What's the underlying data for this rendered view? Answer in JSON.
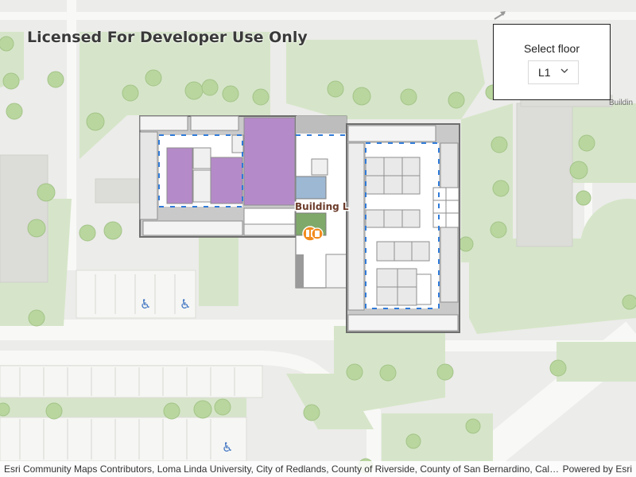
{
  "map": {
    "watermark": "Licensed For Developer Use Only",
    "building_label": "Building L",
    "edge_label": "Buildin"
  },
  "floor_picker": {
    "title": "Select floor",
    "selected": "L1"
  },
  "attribution": {
    "text": "Esri Community Maps Contributors, Loma Linda University, City of Redlands, County of Riverside, County of San Bernardino, California State Parks, © OpenStreetMap, Microsoft, Esri, TomTom, Garmin, SafeGraph, GeoTechnologies, Inc, METI/NASA, USGS, Bureau of Land Management, EPA, NPS, US Census Bureau, USDA, USFWS",
    "powered_by": "Powered by Esri"
  },
  "colors": {
    "land": "#ececea",
    "green": "#d6e5c9",
    "tree": "#b9d69f",
    "building": "#dcdcd8",
    "room": "#ffffff",
    "wall": "#8e8e8e",
    "purple": "#b48bc8",
    "water": "#9db8d3",
    "plaza": "#7fa96a",
    "dash": "#2f7ad8",
    "poi": "#f28b1e"
  },
  "icons": [
    "accessible-parking-icon",
    "accessible-parking-icon",
    "accessible-parking-icon",
    "elevator-icon",
    "chevron-down-icon",
    "north-arrow-icon"
  ]
}
